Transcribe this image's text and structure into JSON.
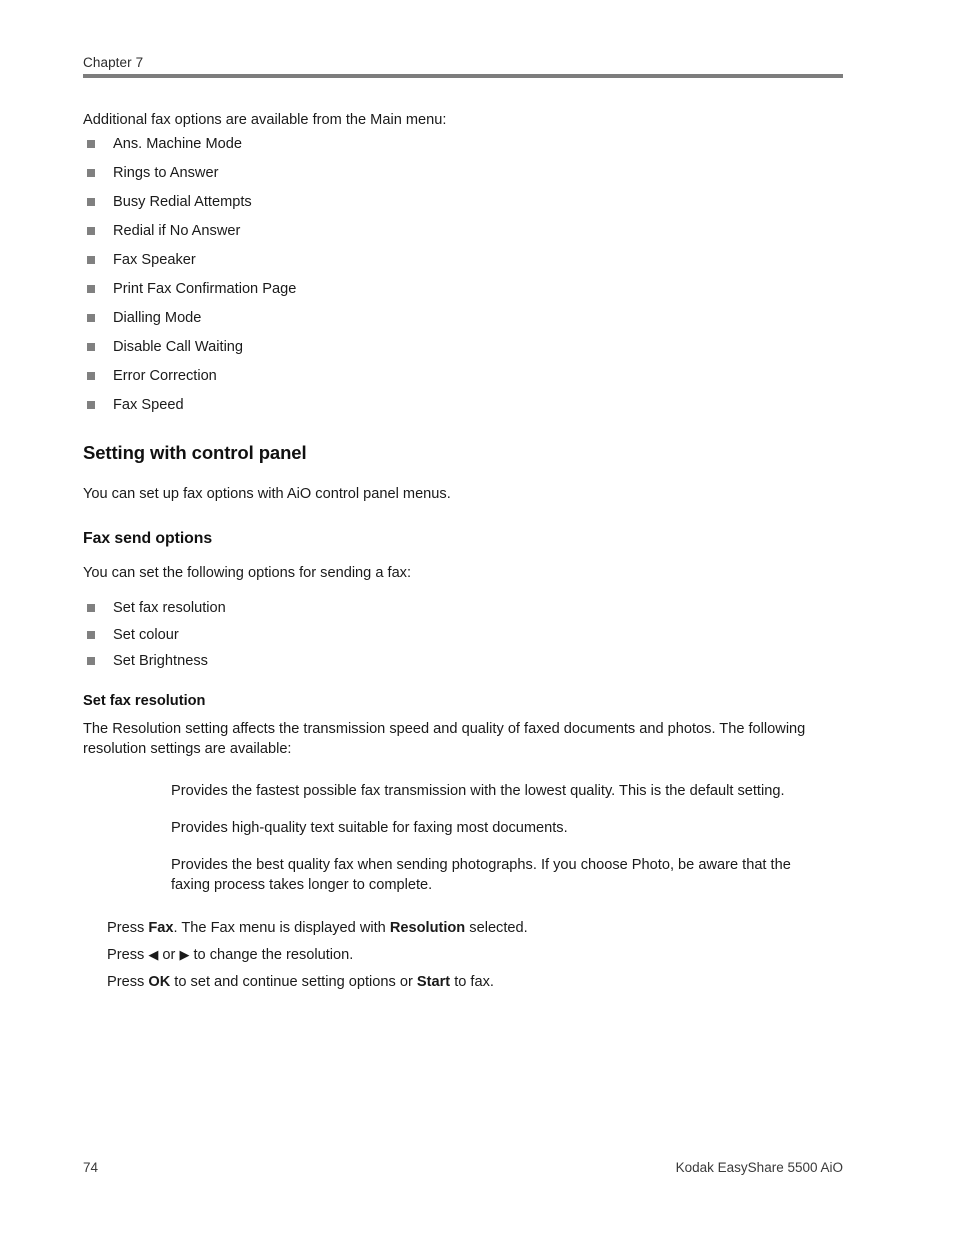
{
  "header": {
    "chapter_label": "Chapter 7"
  },
  "intro": {
    "text": "Additional fax options are available from the Main menu:"
  },
  "main_menu_options": [
    "Ans. Machine Mode",
    "Rings to Answer",
    "Busy Redial Attempts",
    "Redial if No Answer",
    "Fax Speaker",
    "Print Fax Confirmation Page",
    "Dialling Mode",
    "Disable Call Waiting",
    "Error Correction",
    "Fax Speed"
  ],
  "section": {
    "heading": "Setting with control panel",
    "intro": "You can set up fax options with AiO control panel menus."
  },
  "fax_send": {
    "heading": "Fax send options",
    "intro": "You can set the following options for sending a fax:",
    "options": [
      "Set fax resolution",
      "Set colour",
      "Set Brightness"
    ]
  },
  "set_fax_resolution": {
    "heading": "Set fax resolution",
    "intro": "The Resolution setting affects the transmission speed and quality of faxed documents and photos. The following resolution settings are available:",
    "definitions": [
      {
        "term": "",
        "description": "Provides the fastest possible fax transmission with the lowest quality. This is the default setting."
      },
      {
        "term": "",
        "description": "Provides high-quality text suitable for faxing most documents."
      },
      {
        "term": "",
        "description": "Provides the best quality fax when sending photographs. If you choose Photo, be aware that the faxing process takes longer to complete."
      }
    ],
    "steps": {
      "step1": {
        "prefix": "Press ",
        "key": "Fax",
        "middle": ". The Fax menu is displayed with ",
        "key2": "Resolution",
        "suffix": " selected."
      },
      "step2": {
        "prefix": "Press ",
        "left_arrow": "◀",
        "conjunction": " or ",
        "right_arrow": "▶",
        "suffix": " to change the resolution."
      },
      "step3": {
        "prefix": "Press ",
        "key": "OK",
        "middle": " to set and continue setting options or ",
        "key2": "Start",
        "suffix": " to fax."
      }
    }
  },
  "footer": {
    "page_number": "74",
    "product": "Kodak EasyShare 5500 AiO"
  }
}
